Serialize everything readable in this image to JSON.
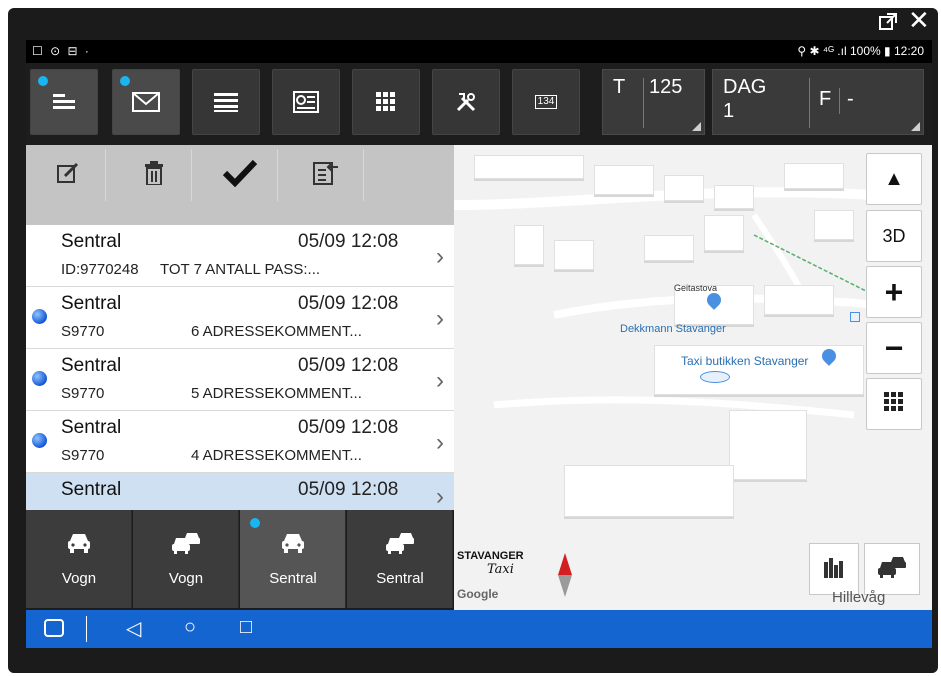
{
  "window": {
    "popout_icon": "popout-icon",
    "close_icon": "close-icon"
  },
  "status_bar": {
    "left_icons": "☐ ⊙ ⊟ ·",
    "battery": "100%",
    "time": "12:20"
  },
  "toolbar": {
    "buttons": [
      {
        "name": "menu-lines-icon",
        "badge": true
      },
      {
        "name": "mail-icon",
        "badge": true
      },
      {
        "name": "list-icon",
        "badge": false
      },
      {
        "name": "receipt-icon",
        "badge": false
      },
      {
        "name": "grid-icon",
        "badge": false
      },
      {
        "name": "tools-icon",
        "badge": false
      },
      {
        "name": "meter-icon",
        "badge": false,
        "label": "134"
      }
    ],
    "t_field": {
      "label": "T",
      "value": "125"
    },
    "dag_field": {
      "label": "DAG",
      "value": "1",
      "f_label": "F",
      "f_value": "-"
    }
  },
  "actions": [
    "edit-icon",
    "delete-icon",
    "check-icon",
    "export-icon"
  ],
  "messages": [
    {
      "sender": "Sentral",
      "time": "05/09 12:08",
      "id": "ID:9770248",
      "text": "TOT  7 ANTALL PASS:...",
      "unread": false,
      "selected": false
    },
    {
      "sender": "Sentral",
      "time": "05/09 12:08",
      "id": "S9770",
      "text": "6 ADRESSEKOMMENT...",
      "unread": true,
      "selected": false
    },
    {
      "sender": "Sentral",
      "time": "05/09 12:08",
      "id": "S9770",
      "text": "5 ADRESSEKOMMENT...",
      "unread": true,
      "selected": false
    },
    {
      "sender": "Sentral",
      "time": "05/09 12:08",
      "id": "S9770",
      "text": "4 ADRESSEKOMMENT...",
      "unread": true,
      "selected": false
    },
    {
      "sender": "Sentral",
      "time": "05/09 12:08",
      "id": "",
      "text": "",
      "unread": false,
      "selected": true
    }
  ],
  "vehicle_tabs": [
    {
      "label": "Vogn",
      "icon": "car-icon",
      "active": false,
      "badge": false
    },
    {
      "label": "Vogn",
      "icon": "cars-icon",
      "active": false,
      "badge": false
    },
    {
      "label": "Sentral",
      "icon": "car-icon",
      "active": true,
      "badge": true
    },
    {
      "label": "Sentral",
      "icon": "cars-icon",
      "active": false,
      "badge": false
    }
  ],
  "map": {
    "street_label": "Geitastova",
    "poi_1": "Dekkmann Stavanger",
    "poi_2": "Taxi butikken Stavanger",
    "brand_line1": "STAVANGER",
    "brand_line2": "Taxi",
    "google": "Google",
    "area_label": "Hillevåg",
    "controls": {
      "compass": "▲",
      "three_d": "3D",
      "zoom_in": "+",
      "zoom_out": "−",
      "grid": "grid-icon"
    }
  },
  "nav": {
    "back": "◁",
    "home": "○",
    "recent": "□"
  },
  "colors": {
    "accent_dot": "#19b5f0",
    "navbar": "#1565d0",
    "selected_row": "#cfe0f3",
    "toolbar": "#1d1d1d"
  }
}
